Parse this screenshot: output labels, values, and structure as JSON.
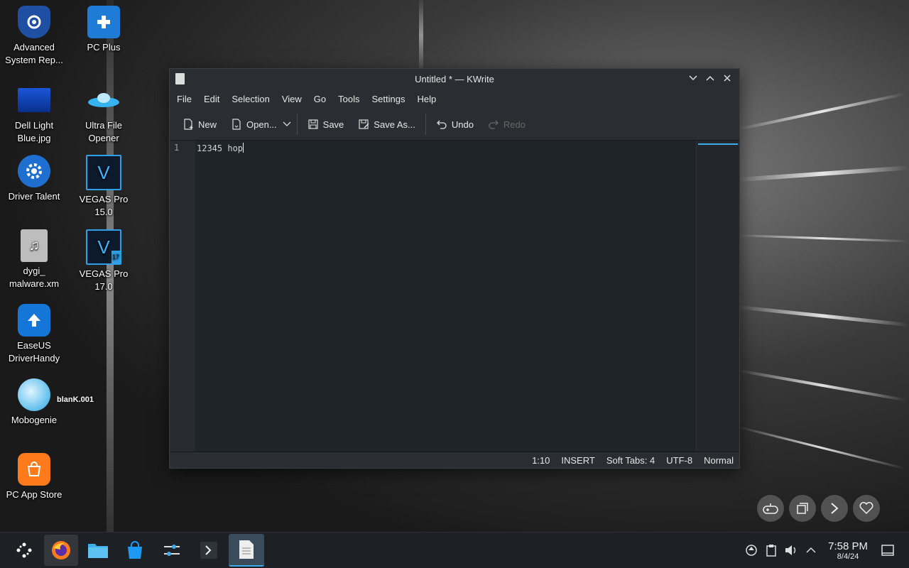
{
  "desktop": {
    "icons": [
      {
        "label": "Advanced System Rep...",
        "icon": "shield-gear-icon"
      },
      {
        "label": "PC Plus",
        "icon": "medical-case-icon"
      },
      {
        "label": "Dell Light Blue.jpg",
        "icon": "image-file-icon"
      },
      {
        "label": "Ultra File Opener",
        "icon": "ufo-icon"
      },
      {
        "label": "Driver Talent",
        "icon": "gear-icon"
      },
      {
        "label": "VEGAS Pro 15.0",
        "icon": "vegas-icon"
      },
      {
        "label": "dygi_ malware.xm",
        "icon": "audio-file-icon"
      },
      {
        "label": "VEGAS Pro 17.0",
        "icon": "vegas-icon"
      },
      {
        "label": "EaseUS DriverHandy",
        "icon": "upload-icon"
      },
      {
        "label": "Mobogenie",
        "icon": "mobogenie-icon"
      },
      {
        "label": "PC App Store",
        "icon": "shopping-bag-icon"
      }
    ],
    "blank_label": "blanK.001",
    "vegas_letter": "V",
    "vegas17_badge": "17"
  },
  "window": {
    "title": "Untitled * — KWrite",
    "menu": [
      "File",
      "Edit",
      "Selection",
      "View",
      "Go",
      "Tools",
      "Settings",
      "Help"
    ],
    "toolbar": {
      "new": "New",
      "open": "Open...",
      "save": "Save",
      "save_as": "Save As...",
      "undo": "Undo",
      "redo": "Redo"
    },
    "editor": {
      "line_number": "1",
      "text": "12345 hop"
    },
    "status": {
      "position": "1:10",
      "mode": "INSERT",
      "tabs": "Soft Tabs: 4",
      "encoding": "UTF-8",
      "highlight": "Normal"
    }
  },
  "taskbar": {
    "time": "7:58 PM",
    "date": "8/4/24"
  },
  "colors": {
    "accent": "#3daee9",
    "window_bg": "#1f232a",
    "panel_bg": "#2a2e32"
  }
}
